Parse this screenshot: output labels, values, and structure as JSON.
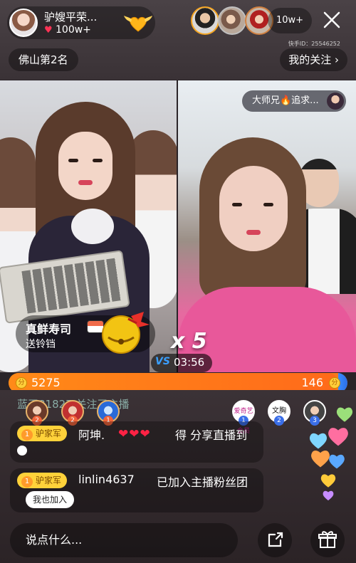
{
  "host": {
    "name": "驴嫂平荣...",
    "likes": "100w+"
  },
  "viewers": {
    "count": "10w+"
  },
  "rank_label": "佛山第2名",
  "follow_label": "我的关注",
  "uid_label": "快手ID：25546252",
  "pk": {
    "chat_tag": "大师兄🔥追求...",
    "gift_name": "真鲜寿司",
    "gift_sub": "送铃铛",
    "combo": "x 5",
    "vs_label": "VS",
    "timer": "03:56",
    "score_left": "5275",
    "score_right": "146",
    "score_left_fraction": 0.973,
    "coin_symbol": "分"
  },
  "notice": "蓝天81827 关注了主播",
  "top_gifter_badges": [
    "2",
    "2",
    "1"
  ],
  "rank_avatars": [
    {
      "label": "爱奇艺会员",
      "badge": "1"
    },
    {
      "label": "文胸",
      "badge": "2"
    },
    {
      "label": "",
      "badge": "3"
    }
  ],
  "comments": [
    {
      "fan_level": "1",
      "fan_badge": "驴家军",
      "user": "阿坤.",
      "text": "得 分享直播到"
    },
    {
      "fan_level": "1",
      "fan_badge": "驴家军",
      "user": "linlin4637",
      "text": "已加入主播粉丝团",
      "action_label": "我也加入"
    }
  ],
  "input_placeholder": "说点什么...",
  "colors": {
    "orange": "#ff8a18",
    "blue": "#3a8cff",
    "badge_yellow": "#ffd23a",
    "heart_red": "#ff2244"
  }
}
